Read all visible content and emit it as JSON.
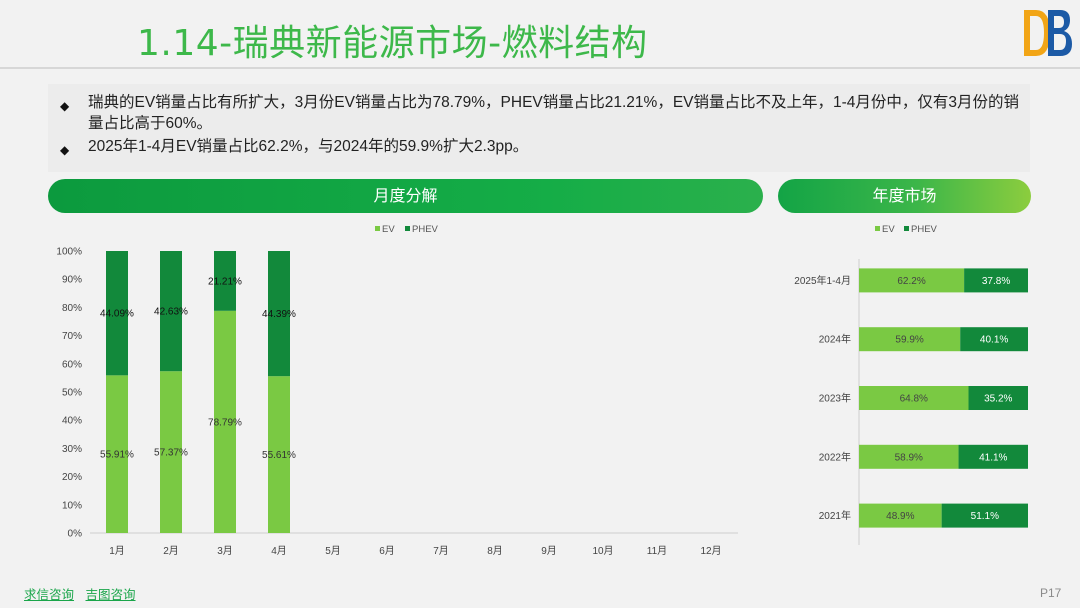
{
  "header": {
    "title": "1.14-瑞典新能源市场-燃料结构",
    "colors": {
      "title": "#3db84a",
      "badge": "#3db84a"
    }
  },
  "bullets": [
    "瑞典的EV销量占比有所扩大，3月份EV销量占比为78.79%，PHEV销量占比21.21%，EV销量占比不及上年，1-4月份中，仅有3月份的销量占比高于60%。",
    "2025年1-4月EV销量占比62.2%，与2024年的59.9%扩大2.3pp。"
  ],
  "sections": {
    "monthly": "月度分解",
    "yearly": "年度市场"
  },
  "footer": {
    "links": [
      "求信咨询",
      "吉图咨询"
    ],
    "page": "P17"
  },
  "colors": {
    "ev": "#7ac943",
    "phev": "#12893b"
  },
  "chart_data": [
    {
      "type": "bar",
      "stacked": true,
      "categories": [
        "1月",
        "2月",
        "3月",
        "4月",
        "5月",
        "6月",
        "7月",
        "8月",
        "9月",
        "10月",
        "11月",
        "12月"
      ],
      "series": [
        {
          "name": "EV",
          "values": [
            55.91,
            57.37,
            78.79,
            55.61,
            null,
            null,
            null,
            null,
            null,
            null,
            null,
            null
          ]
        },
        {
          "name": "PHEV",
          "values": [
            44.09,
            42.63,
            21.21,
            44.39,
            null,
            null,
            null,
            null,
            null,
            null,
            null,
            null
          ]
        }
      ],
      "ylim": [
        0,
        100
      ],
      "yticks": [
        "0%",
        "10%",
        "20%",
        "30%",
        "40%",
        "50%",
        "60%",
        "70%",
        "80%",
        "90%",
        "100%"
      ],
      "legend": "top"
    },
    {
      "type": "bar",
      "orientation": "horizontal",
      "stacked": true,
      "categories": [
        "2025年1-4月",
        "2024年",
        "2023年",
        "2022年",
        "2021年"
      ],
      "series": [
        {
          "name": "EV",
          "values": [
            62.2,
            59.9,
            64.8,
            58.9,
            48.9
          ]
        },
        {
          "name": "PHEV",
          "values": [
            37.8,
            40.1,
            35.2,
            41.1,
            51.1
          ]
        }
      ],
      "xlim": [
        0,
        100
      ],
      "legend": "top"
    }
  ]
}
